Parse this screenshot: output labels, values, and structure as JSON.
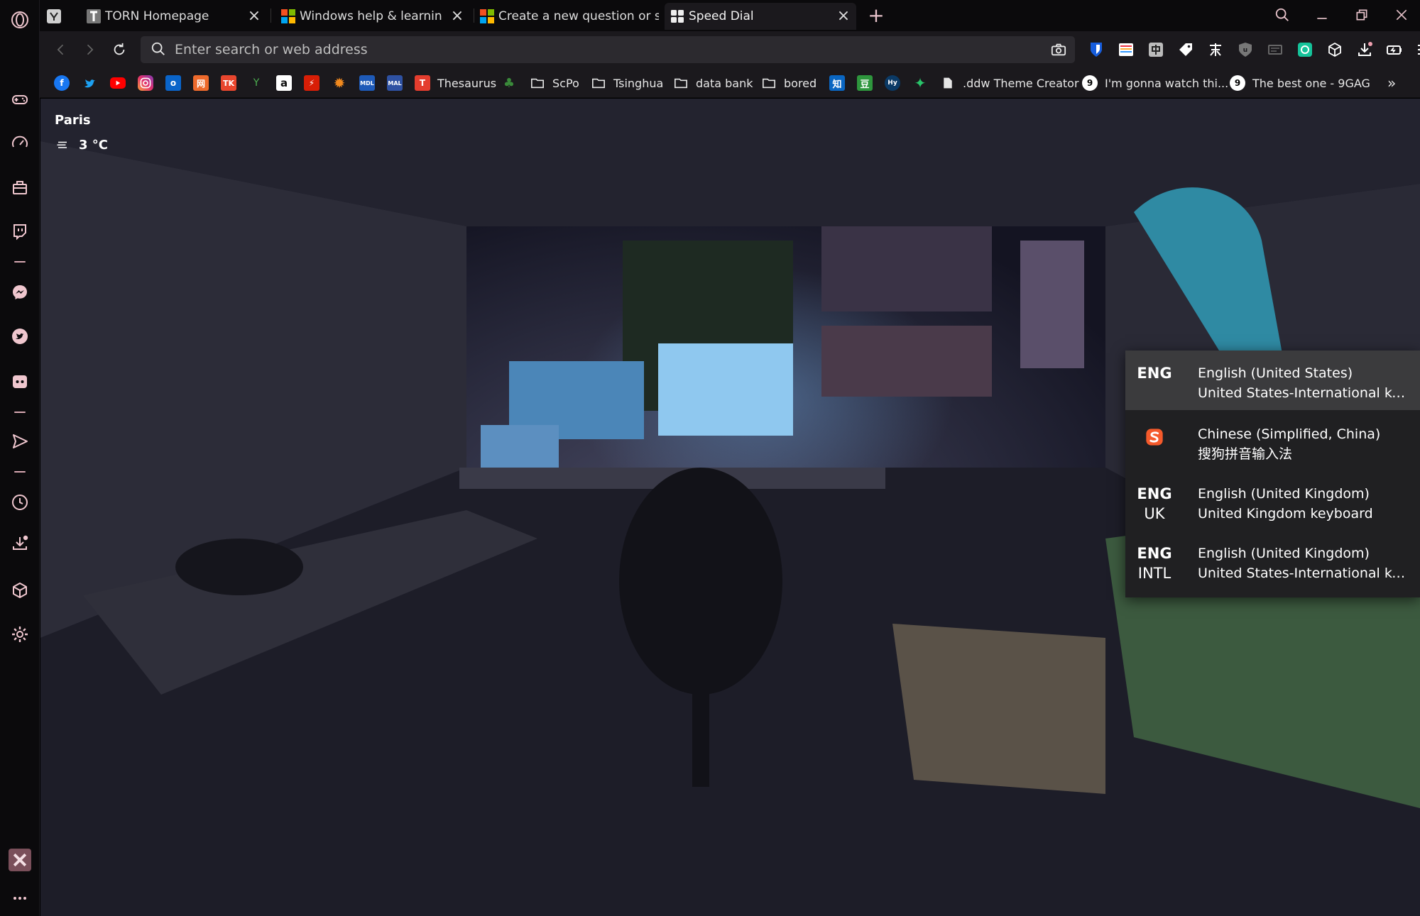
{
  "tabs": [
    {
      "title": "TORN Homepage",
      "favicon": "torn-icon"
    },
    {
      "title": "Windows help & learning -",
      "favicon": "microsoft-icon"
    },
    {
      "title": "Create a new question or s",
      "favicon": "microsoft-icon"
    },
    {
      "title": "Speed Dial",
      "favicon": "speed-dial-icon",
      "active": true
    }
  ],
  "new_tab_label": "+",
  "address_bar": {
    "placeholder": "Enter search or web address",
    "value": ""
  },
  "bookmarks": {
    "thesaurus": "Thesaurus",
    "scpo": "ScPo",
    "tsinghua": "Tsinghua",
    "data_bank": "data bank",
    "bored": "bored",
    "ddw": ".ddw Theme Creator",
    "gag1": "I'm gonna watch thi...",
    "gag2": "The best one - 9GAG",
    "more": "»"
  },
  "weather": {
    "city": "Paris",
    "temperature": "3 °C"
  },
  "language_menu": [
    {
      "code": "ENG",
      "variant": "",
      "language": "English (United States)",
      "keyboard": "United States-International ke...",
      "selected": true
    },
    {
      "code": "",
      "variant": "",
      "icon": "sogou-icon",
      "language": "Chinese (Simplified, China)",
      "keyboard": "搜狗拼音输入法"
    },
    {
      "code": "ENG",
      "variant": "UK",
      "language": "English (United Kingdom)",
      "keyboard": "United Kingdom keyboard"
    },
    {
      "code": "ENG",
      "variant": "INTL",
      "language": "English (United Kingdom)",
      "keyboard": "United States-International ke..."
    }
  ],
  "colors": {
    "accent": "#f0c7cf",
    "chrome_bg": "#1b191d",
    "sidebar_bg": "#0b0a0c",
    "menu_selected": "#3b3b3d"
  }
}
